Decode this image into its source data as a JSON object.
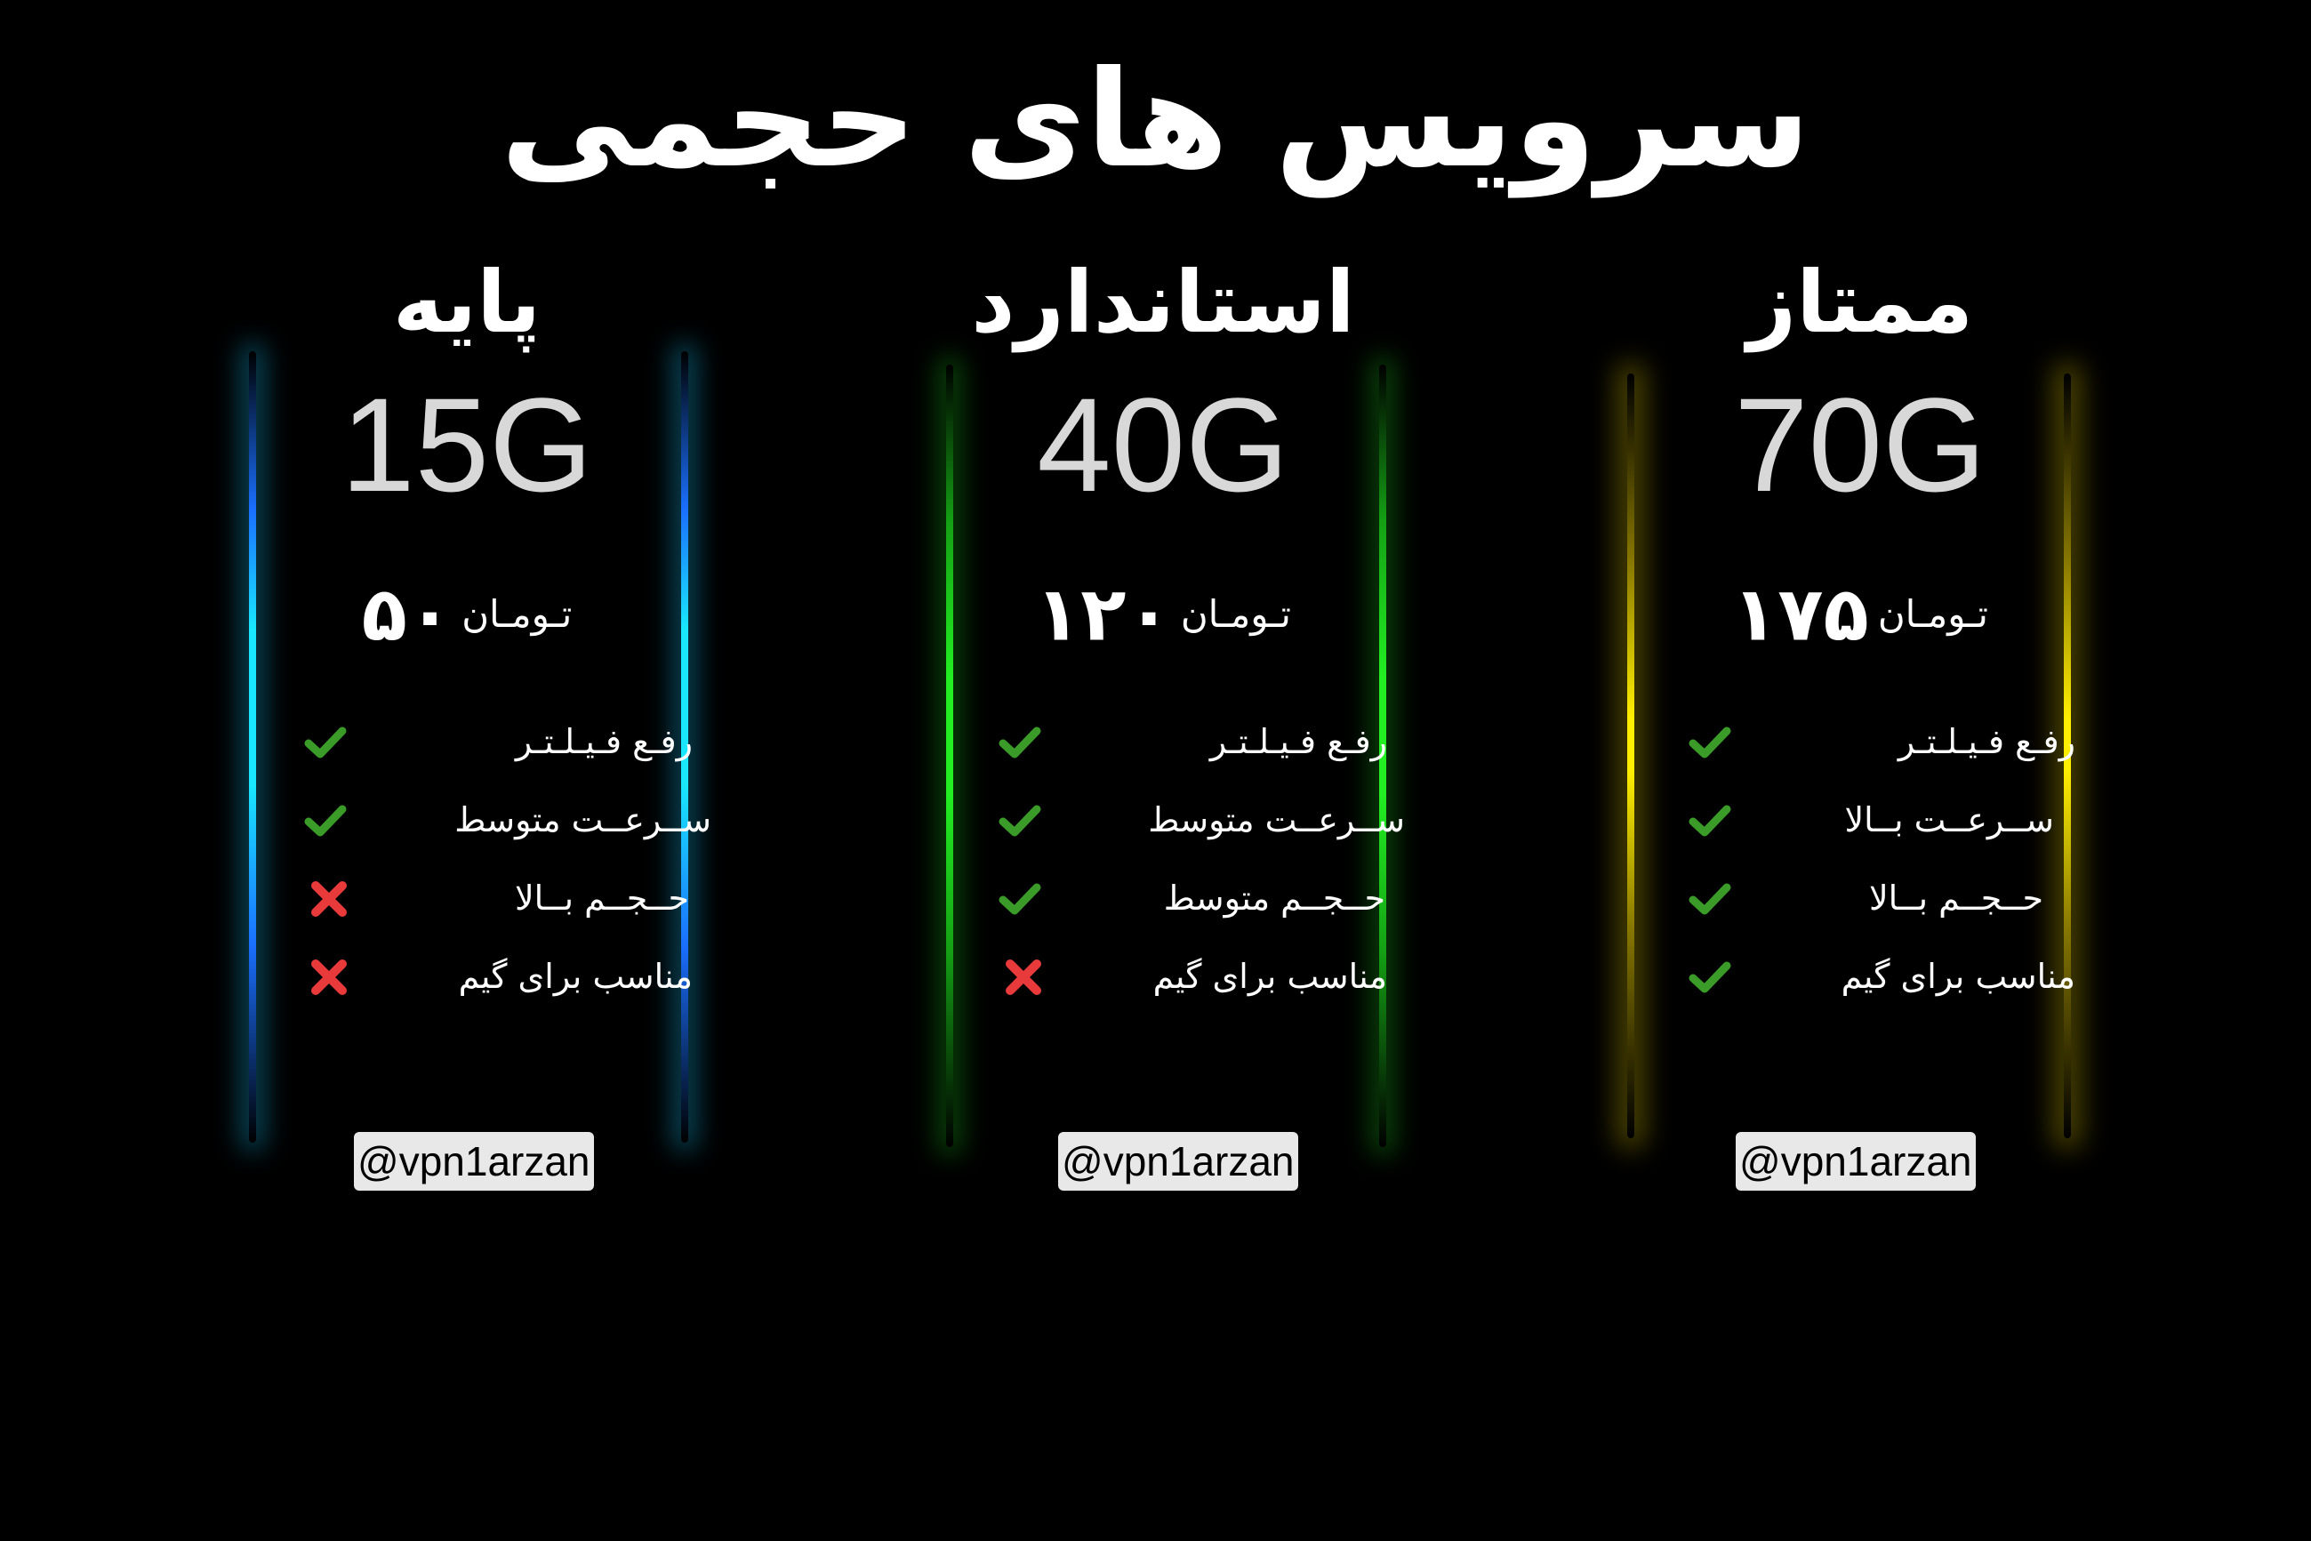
{
  "title": "سرویس های حجمی",
  "colors": {
    "background": "#000000",
    "check": "#3a9b28",
    "cross": "#e83a3a",
    "glow_basic_edge": "#1a4fe0",
    "glow_basic_core": "#19e6ff",
    "glow_standard_core": "#22dd22",
    "glow_premium_core": "#ffee00"
  },
  "plans": [
    {
      "name": "پایه",
      "volume": "15G",
      "price": "۵۰",
      "unit": "تـومـان",
      "features": [
        {
          "label": "رفـع فـیـلـتـر",
          "included": true,
          "icon": "check-icon"
        },
        {
          "label": "ســرعــت متوسط",
          "included": true,
          "icon": "check-icon"
        },
        {
          "label": "حــجــم بــالا",
          "included": false,
          "icon": "cross-icon"
        },
        {
          "label": "مناسب برای گیم",
          "included": false,
          "icon": "cross-icon"
        }
      ],
      "handle": "@vpn1arzan"
    },
    {
      "name": "استاندارد",
      "volume": "40G",
      "price": "۱۲۰",
      "unit": "تـومـان",
      "features": [
        {
          "label": "رفـع فـیـلـتـر",
          "included": true,
          "icon": "check-icon"
        },
        {
          "label": "ســرعــت متوسط",
          "included": true,
          "icon": "check-icon"
        },
        {
          "label": "حــجــم متوسط",
          "included": true,
          "icon": "check-icon"
        },
        {
          "label": "مناسب برای گیم",
          "included": false,
          "icon": "cross-icon"
        }
      ],
      "handle": "@vpn1arzan"
    },
    {
      "name": "ممتاز",
      "volume": "70G",
      "price": "۱۷۵",
      "unit": "تـومـان",
      "features": [
        {
          "label": "رفـع فـیـلـتـر",
          "included": true,
          "icon": "check-icon"
        },
        {
          "label": "ســرعــت بــالا",
          "included": true,
          "icon": "check-icon"
        },
        {
          "label": "حــجــم بــالا",
          "included": true,
          "icon": "check-icon"
        },
        {
          "label": "مناسب برای گیم",
          "included": true,
          "icon": "check-icon"
        }
      ],
      "handle": "@vpn1arzan"
    }
  ]
}
